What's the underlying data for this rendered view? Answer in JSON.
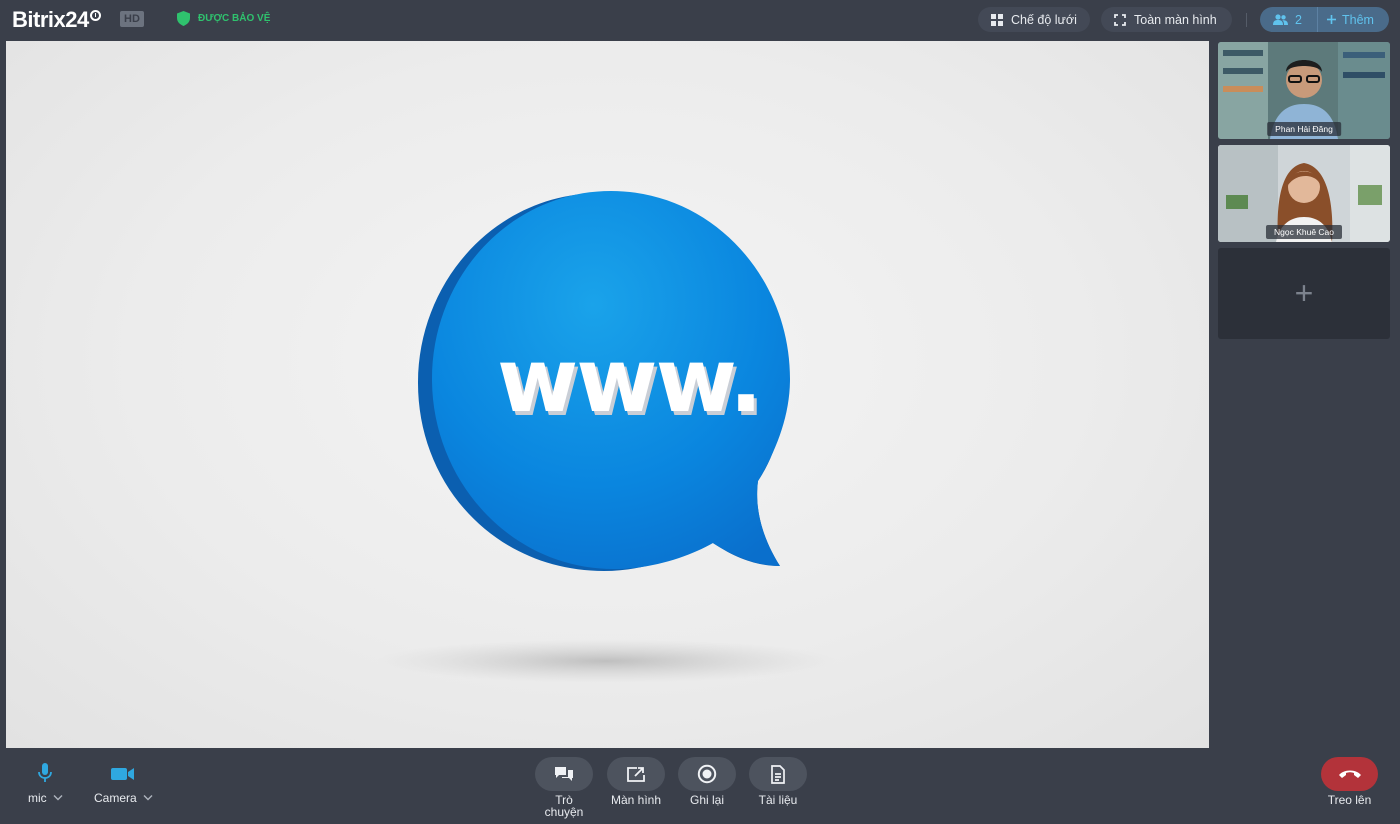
{
  "app": {
    "logo_text": "Bitrix24",
    "hd_badge": "HD",
    "protected_label": "ĐƯỢC BẢO VỆ"
  },
  "toolbar": {
    "grid_mode_label": "Chế độ lưới",
    "fullscreen_label": "Toàn màn hình",
    "participant_count": "2",
    "add_label": "Thêm"
  },
  "stage": {
    "shared_content_text": "www."
  },
  "participants": [
    {
      "name": "Phan Hải Đăng"
    },
    {
      "name": "Ngọc Khuê Cao"
    }
  ],
  "add_tile_symbol": "+",
  "controls": {
    "mic_label": "mic",
    "camera_label": "Camera",
    "chat_label_line1": "Trò",
    "chat_label_line2": "chuyện",
    "screen_label": "Màn hình",
    "record_label": "Ghi lại",
    "docs_label": "Tài liệu",
    "hangup_label": "Treo lên"
  },
  "colors": {
    "accent_blue": "#2fa8e0",
    "protected_green": "#2fc26e",
    "hangup_red": "#b3333a",
    "background": "#3a3f4a"
  }
}
